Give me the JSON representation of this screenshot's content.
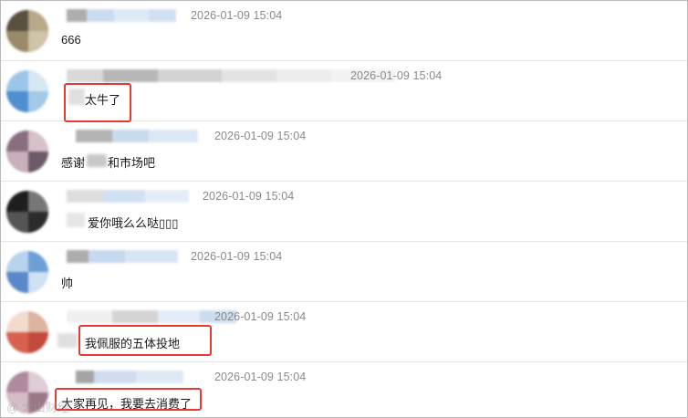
{
  "comments": [
    {
      "timestamp": "2026-01-09 15:04",
      "text": "666"
    },
    {
      "timestamp": "2026-01-09 15:04",
      "text": "太牛了"
    },
    {
      "timestamp": "2026-01-09 15:04",
      "text_before": "感谢",
      "text_after": "和市场吧"
    },
    {
      "timestamp": "2026-01-09 15:04",
      "text": "爱你哦么么哒▯▯▯"
    },
    {
      "timestamp": "2026-01-09 15:04",
      "text": "帅"
    },
    {
      "timestamp": "2026-01-09 15:04",
      "text": "我佩服的五体投地"
    },
    {
      "timestamp": "2026-01-09 15:04",
      "text": "大家再见，我要去消费了"
    }
  ],
  "highlight_color": "#e53935",
  "watermark": "@ 大山财经"
}
